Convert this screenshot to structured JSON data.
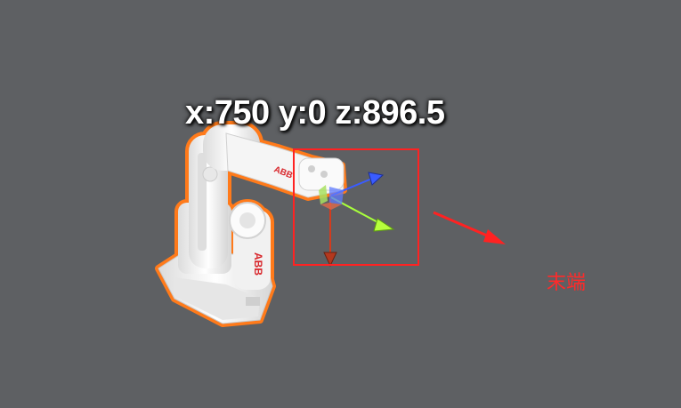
{
  "viewport": {
    "background_color": "#5e6063"
  },
  "robot": {
    "brand": "ABB",
    "body_color": "#f4f4f4",
    "outline_color": "#ff7a1a",
    "logo_color": "#d8262b"
  },
  "end_effector": {
    "coordinate_text": "x:750 y:0 z:896.5",
    "gizmo_colors": {
      "x_axis": "#a8ff3c",
      "y_axis": "#3a5cff",
      "z_axis": "#d23c1e"
    }
  },
  "annotation": {
    "label": "末端",
    "color": "#ff2222"
  }
}
